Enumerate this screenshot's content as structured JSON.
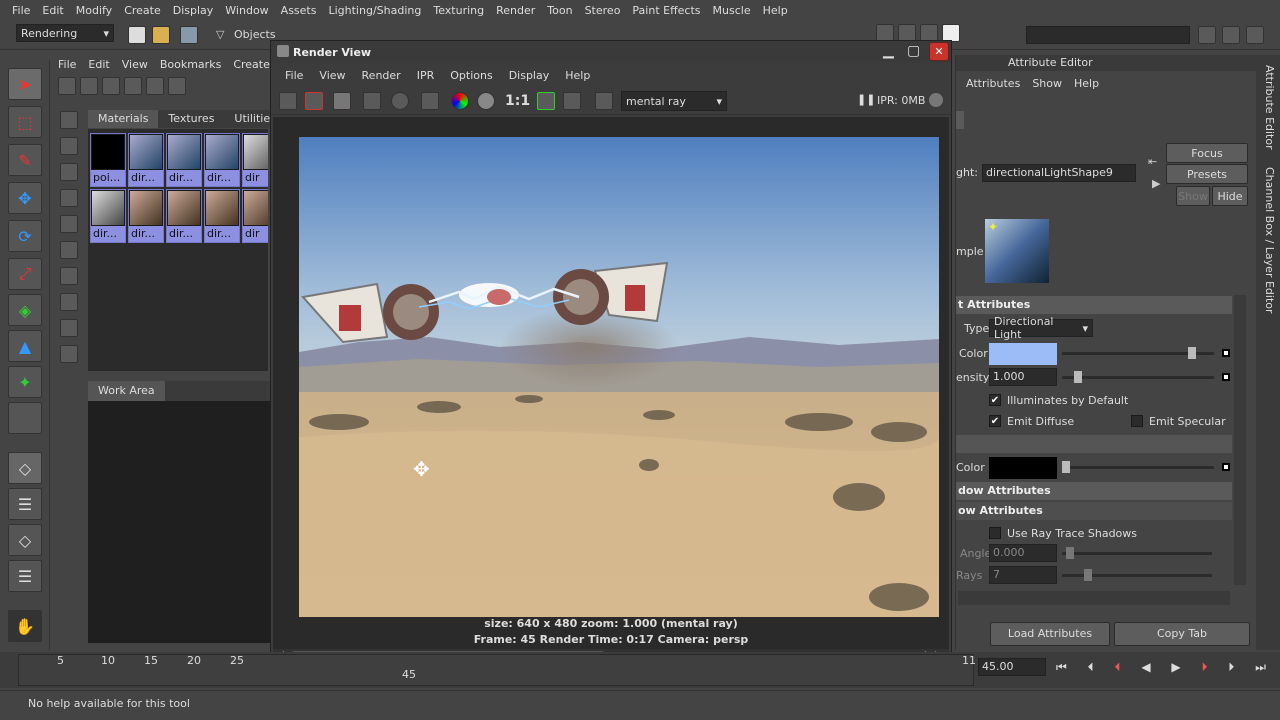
{
  "menubar": [
    "File",
    "Edit",
    "Modify",
    "Create",
    "Display",
    "Window",
    "Assets",
    "Lighting/Shading",
    "Texturing",
    "Render",
    "Toon",
    "Stereo",
    "Paint Effects",
    "Muscle",
    "Help"
  ],
  "shelf": {
    "menu_set": "Rendering",
    "objects_label": "Objects"
  },
  "hypershade": {
    "menus": [
      "File",
      "Edit",
      "View",
      "Bookmarks",
      "Create"
    ],
    "tabs": [
      "Materials",
      "Textures",
      "Utilities"
    ],
    "row1": [
      "poi...",
      "dir...",
      "dir...",
      "dir...",
      "dir"
    ],
    "row2": [
      "dir...",
      "dir...",
      "dir...",
      "dir...",
      "dir"
    ],
    "work_area": "Work Area"
  },
  "render_view": {
    "title": "Render View",
    "menus": [
      "File",
      "View",
      "Render",
      "IPR",
      "Options",
      "Display",
      "Help"
    ],
    "ratio_label": "1:1",
    "renderer": "mental ray",
    "ipr_memory": "IPR: 0MB",
    "info_line1": "size: 640 x 480 zoom: 1.000        (mental ray)",
    "info_line2": "Frame: 45      Render Time: 0:17      Camera: persp"
  },
  "attribute_editor": {
    "title": "Attribute Editor",
    "menus": [
      "Attributes",
      "Show",
      "Help"
    ],
    "light_label": "ght:",
    "light_name": "directionalLightShape9",
    "focus": "Focus",
    "presets": "Presets",
    "show": "Show",
    "hide": "Hide",
    "sample_label": "mple",
    "section_light": "t Attributes",
    "type_label": "Type",
    "type_value": "Directional Light",
    "color_label": "Color",
    "color_value": "#9bbcf7",
    "intensity_label": "ensity",
    "intensity_value": "1.000",
    "illum_default": "Illuminates by Default",
    "emit_diffuse": "Emit Diffuse",
    "emit_specular": "Emit Specular",
    "shadow_color_label": "Color",
    "shadow_color_value": "#000000",
    "section_shadow1": "dow Attributes",
    "section_shadow2": "ow Attributes",
    "use_raytrace": "Use Ray Trace Shadows",
    "angle_label": "Angle",
    "angle_value": "0.000",
    "rays_label": "Rays",
    "rays_value": "7",
    "load_attributes": "Load Attributes",
    "copy_tab": "Copy Tab"
  },
  "side_tabs": [
    "Attribute Editor",
    "Channel Box / Layer Editor"
  ],
  "timeline": {
    "ticks": [
      "5",
      "10",
      "15",
      "20",
      "25"
    ],
    "current_label": "45",
    "end_label": "11",
    "current_frame": "45.00"
  },
  "help_line": "No help available for this tool"
}
